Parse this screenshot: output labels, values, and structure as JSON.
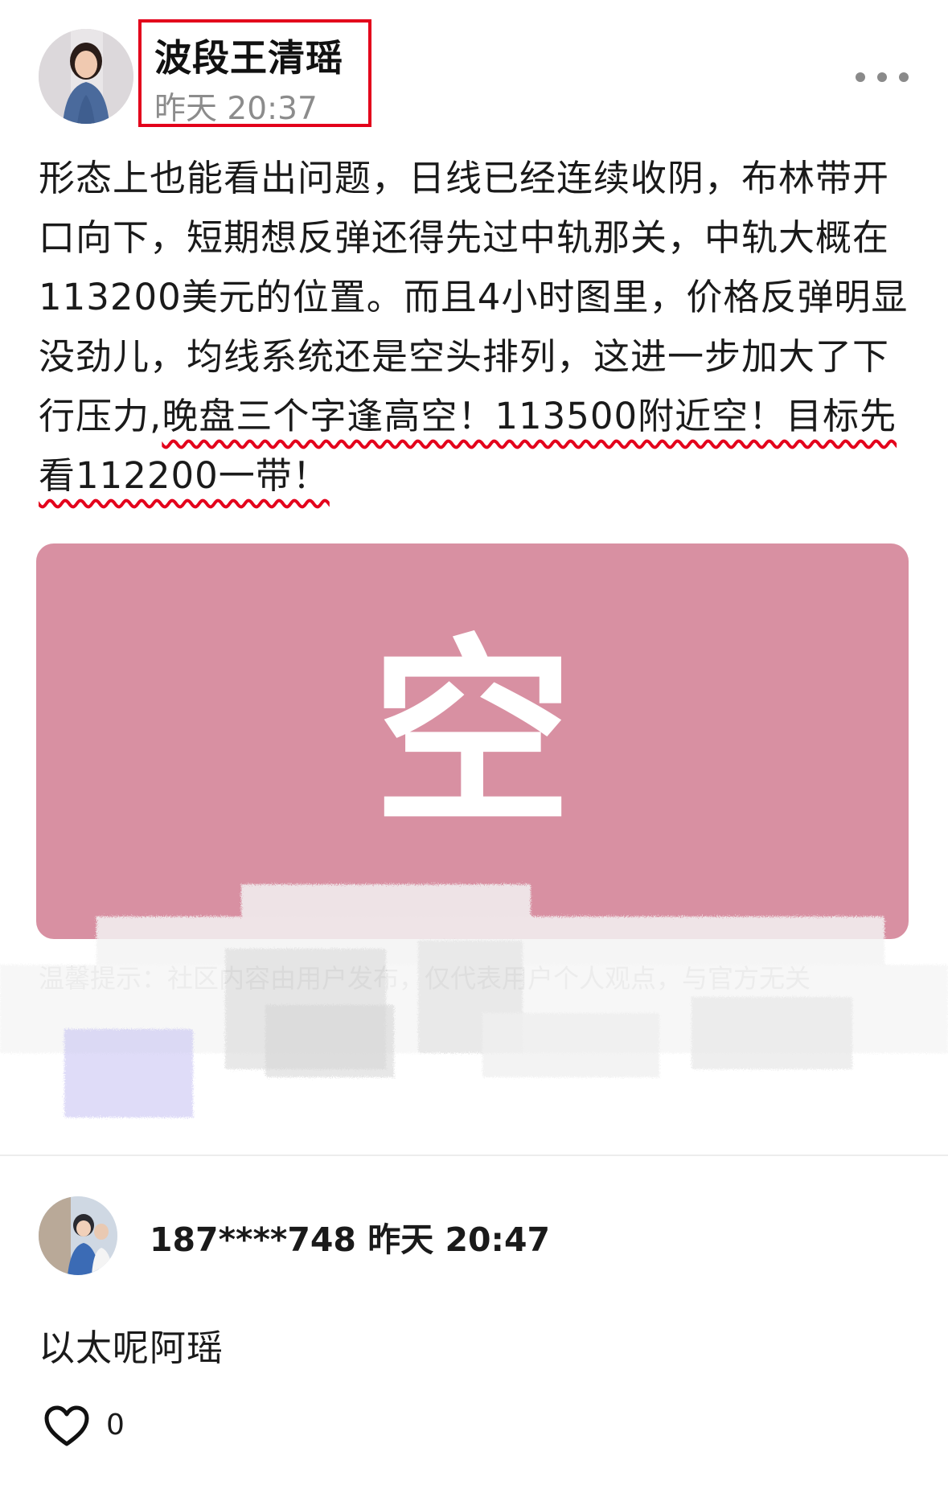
{
  "post": {
    "author": {
      "name": "波段王清瑶",
      "time": "昨天 20:37"
    },
    "text_plain": "形态上也能看出问题，日线已经连续收阴，布林带开口向下，短期想反弹还得先过中轨那关，中轨大概在113200美元的位置。而且4小时图里，价格反弹明显没劲儿，均线系统还是空头排列，这进一步加大了下行压力,",
    "text_highlight": "晚盘三个字逢高空！113500附近空！目标先看112200一带！",
    "media": {
      "character": "空",
      "background_color": "#d890a2"
    },
    "disclaimer": "温馨提示：社区内容由用户发布，仅代表用户个人观点，与官方无关"
  },
  "comment": {
    "user": "187****748",
    "time": "昨天 20:47",
    "text": "以太呢阿瑶",
    "like_count": "0"
  },
  "colors": {
    "highlight_box": "#e3001b",
    "wavy_underline": "#e3001b",
    "time_gray": "#8c8c8c"
  },
  "icons": [
    "avatar",
    "more-dots-icon",
    "heart-outline-icon"
  ]
}
